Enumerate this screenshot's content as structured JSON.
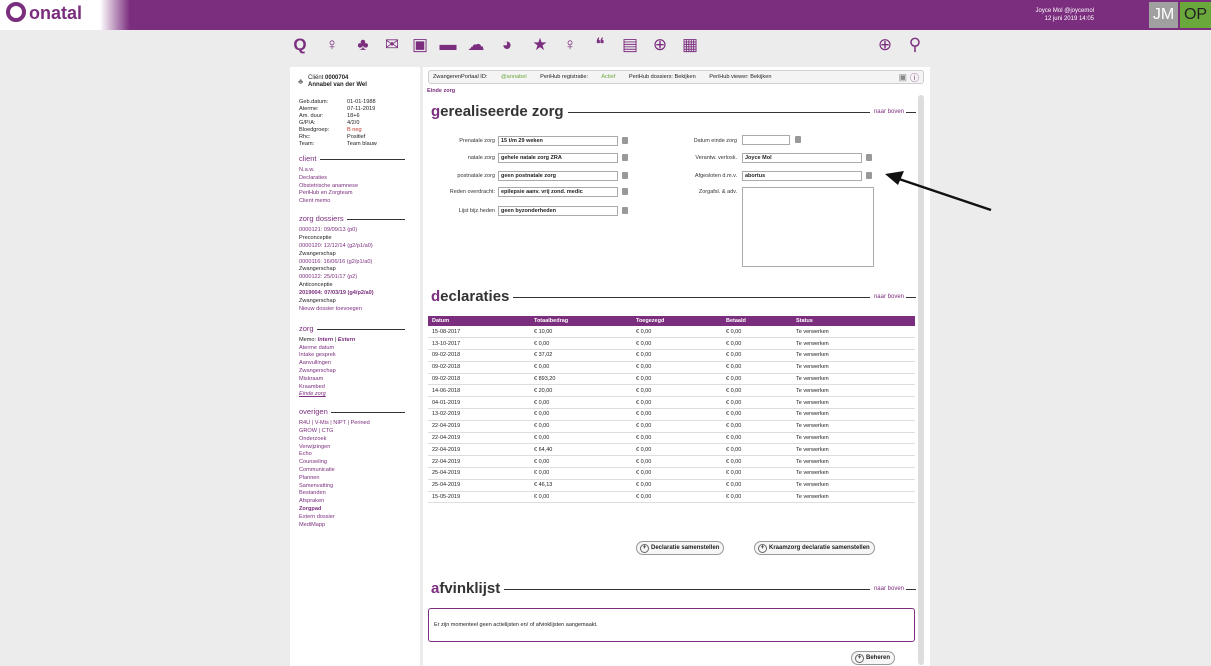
{
  "app": {
    "name": "onatal",
    "user_line1": "Joyce Mol @joycemol",
    "user_line2": "12 juni 2019 14:05",
    "avatar_jm": "JM",
    "avatar_op": "OP"
  },
  "toolbar": {
    "icons": [
      "onatal-icon",
      "pregnant-icon",
      "baby-scale-icon",
      "mail-icon",
      "printer-icon",
      "card-icon",
      "chat-icon",
      "pie-chart-icon",
      "star-icon",
      "pregnant-icon",
      "chat-bubbles-icon",
      "calendar-icon",
      "globe-icon",
      "calculator-icon"
    ],
    "add_icon": "plus-circle-icon",
    "search_icon": "search-icon"
  },
  "client": {
    "label": "Cliënt",
    "number": "0000704",
    "name": "Annabel van der Wel",
    "details": [
      [
        "Geb.datum:",
        "01-01-1988"
      ],
      [
        "Aterme:",
        "07-11-2019"
      ],
      [
        "Am. duur:",
        "18+6"
      ],
      [
        "G/P/A:",
        "4/2/0"
      ],
      [
        "Bloedgroep:",
        "B neg"
      ],
      [
        "Rhc:",
        "Positief"
      ],
      [
        "Team:",
        "Team blauw"
      ]
    ]
  },
  "sidebar": {
    "client_title": "client",
    "client_links": [
      "N.a.w.",
      "Declaraties",
      "Obstetrische anamnese",
      "PeriHub en Zorgteam",
      "Client memo"
    ],
    "dossiers_title": "zorg dossiers",
    "dossiers": [
      [
        "0000121: 09/09/13 (p0)",
        "Preconceptie"
      ],
      [
        "0000120: 12/12/14 (g2/p1/a0)",
        "Zwangerschap"
      ],
      [
        "0000116: 16/06/16 (g2/p1/a0)",
        "Zwangerschap"
      ],
      [
        "0000122: 25/01/17 (p2)",
        "Anticonceptie"
      ],
      [
        "2019004: 07/03/19 (g4/p2/a0)",
        "Zwangerschap"
      ]
    ],
    "new_dossier": "Nieuw dossier toevoegen",
    "zorg_title": "zorg",
    "memo_label": "Memo:",
    "memo_intern": "Intern",
    "memo_sep": "|",
    "memo_extern": "Extern",
    "zorg_links": [
      "Aterme datum",
      "Intake gesprek",
      "Aanvullingen",
      "Zwangerschap",
      "Miskraam",
      "Kraambed",
      "Einde zorg"
    ],
    "overigen_title": "overigen",
    "overigen_line1": "R4U | V-Mis | NIPT | Perined",
    "overigen_line2": "GROW | CTG",
    "overigen_links": [
      "Onderzoek",
      "Verwijzingen",
      "Echo",
      "Counseling",
      "Communicatie",
      "Plannen",
      "Samenvatting",
      "Bestanden",
      "Afspraken",
      "Zorgpad",
      "Extern dossier",
      "MediMapp"
    ]
  },
  "info": {
    "portal": "ZwangerenPortaal ID:",
    "portal_id": "@annabel",
    "reg": "PeriHub registratie:",
    "reg_val": "Actief",
    "dossiers": "PeriHub dossiers: Bekijken",
    "viewer": "PeriHub viewer: Bekijken"
  },
  "breadcrumb": "Einde zorg",
  "zorg_section": {
    "title_first": "g",
    "title_rest": "erealiseerde zorg",
    "top_link": "naar boven",
    "prenatale_label": "Prenatale zorg",
    "prenatale_value": "15 t/m 29 weken",
    "natale_label": "natale zorg",
    "natale_value": "gehele natale zorg ZRA",
    "postnatale_label": "postnatale zorg",
    "postnatale_value": "geen postnatale zorg",
    "reden_label": "Reden overdracht:",
    "reden_value": "epilepsie aanv. vrij zond. medic",
    "lijst_label": "Lijst bijz.heden",
    "lijst_value": "geen byzonderheden",
    "datum_label": "Datum einde zorg",
    "datum_value": "",
    "verantw_label": "Verantw. verlosk.",
    "verantw_value": "Joyce Mol",
    "afgesloten_label": "Afgesloten d.m.v.",
    "afgesloten_value": "abortus",
    "zorgafsl_label": "Zorgafsl. & adv.",
    "zorgafsl_value": ""
  },
  "declaraties": {
    "title_first": "d",
    "title_rest": "eclaraties",
    "top_link": "naar boven",
    "headers": [
      "Datum",
      "Totaalbedrag",
      "Toegezegd",
      "Betaald",
      "Status"
    ],
    "rows": [
      [
        "15-08-2017",
        "€ 10,00",
        "€ 0,00",
        "€ 0,00",
        "Te verwerken"
      ],
      [
        "13-10-2017",
        "€ 0,00",
        "€ 0,00",
        "€ 0,00",
        "Te verwerken"
      ],
      [
        "09-02-2018",
        "€ 37,02",
        "€ 0,00",
        "€ 0,00",
        "Te verwerken"
      ],
      [
        "09-02-2018",
        "€ 0,00",
        "€ 0,00",
        "€ 0,00",
        "Te verwerken"
      ],
      [
        "09-02-2018",
        "€ 893,20",
        "€ 0,00",
        "€ 0,00",
        "Te verwerken"
      ],
      [
        "14-06-2018",
        "€ 20,00",
        "€ 0,00",
        "€ 0,00",
        "Te verwerken"
      ],
      [
        "04-01-2019",
        "€ 0,00",
        "€ 0,00",
        "€ 0,00",
        "Te verwerken"
      ],
      [
        "13-02-2019",
        "€ 0,00",
        "€ 0,00",
        "€ 0,00",
        "Te verwerken"
      ],
      [
        "22-04-2019",
        "€ 0,00",
        "€ 0,00",
        "€ 0,00",
        "Te verwerken"
      ],
      [
        "22-04-2019",
        "€ 0,00",
        "€ 0,00",
        "€ 0,00",
        "Te verwerken"
      ],
      [
        "22-04-2019",
        "€ 64,40",
        "€ 0,00",
        "€ 0,00",
        "Te verwerken"
      ],
      [
        "22-04-2019",
        "€ 0,00",
        "€ 0,00",
        "€ 0,00",
        "Te verwerken"
      ],
      [
        "25-04-2019",
        "€ 0,00",
        "€ 0,00",
        "€ 0,00",
        "Te verwerken"
      ],
      [
        "25-04-2019",
        "€ 46,13",
        "€ 0,00",
        "€ 0,00",
        "Te verwerken"
      ],
      [
        "15-05-2019",
        "€ 0,00",
        "€ 0,00",
        "€ 0,00",
        "Te verwerken"
      ]
    ],
    "btn_samenstellen": "Declaratie samenstellen",
    "btn_kraamzorg": "Kraamzorg declaratie samenstellen"
  },
  "afvinklijst": {
    "title_first": "a",
    "title_rest": "fvinklijst",
    "top_link": "naar boven",
    "empty_text": "Er zijn momenteel geen actielijsten en/ of afvinklijsten aangemaakt.",
    "beheren": "Beheren"
  },
  "colors": {
    "brand": "#7b2d7e",
    "avatar_op": "#6aa83c"
  }
}
